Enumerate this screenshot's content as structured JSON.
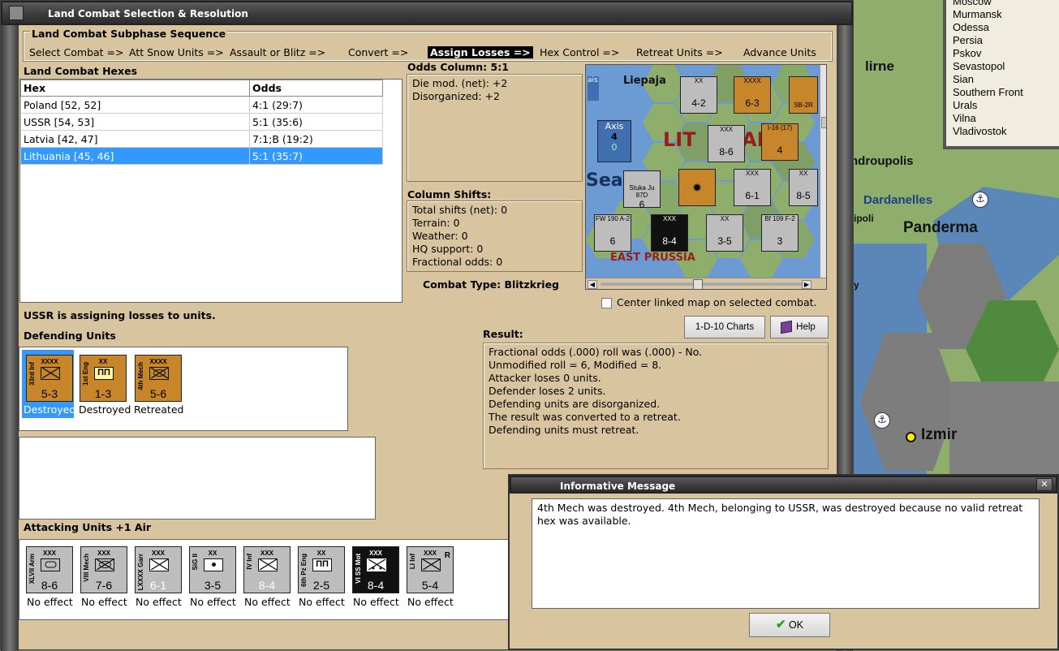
{
  "background_map": {
    "labels": {
      "lirne": "lirne",
      "androupolis": "ndroupolis",
      "dardanelles": "Dardanelles",
      "panderma": "Panderma",
      "ipoli": "ipoli",
      "izmir": "Izmir",
      "y": "y"
    },
    "city_list": [
      "Moscow",
      "Murmansk",
      "Odessa",
      "Persia",
      "Pskov",
      "Sevastopol",
      "Sian",
      "Southern Front",
      "Urals",
      "Vilna",
      "Vladivostok"
    ]
  },
  "window": {
    "title": "Land Combat Selection & Resolution",
    "close_glyph": "✕"
  },
  "sequence": {
    "heading": "Land Combat Subphase Sequence",
    "steps": [
      "Select Combat =>",
      "Att Snow Units =>",
      "Assault or Blitz =>",
      "Convert =>",
      "Assign Losses =>",
      "Hex Control =>",
      "Retreat Units =>",
      "Advance Units"
    ],
    "active_index": 4
  },
  "hexes": {
    "heading": "Land Combat Hexes",
    "columns": [
      "Hex",
      "Odds"
    ],
    "rows": [
      {
        "hex": "Poland [52, 52]",
        "odds": "4:1 (29:7)"
      },
      {
        "hex": "USSR [54, 53]",
        "odds": "5:1 (35:6)"
      },
      {
        "hex": "Latvia [42, 47]",
        "odds": "7:1;B (19:2)"
      },
      {
        "hex": "Lithuania [45, 46]",
        "odds": "5:1 (35:7)"
      }
    ],
    "selected_index": 3
  },
  "odds": {
    "heading": "Odds Column: 5:1",
    "lines": [
      "Die mod. (net): +2",
      "Disorganized: +2"
    ]
  },
  "shifts": {
    "heading": "Column Shifts:",
    "lines": [
      "Total shifts (net): 0",
      "Terrain: 0",
      "Weather: 0",
      "HQ support: 0",
      "Fractional odds: 0"
    ]
  },
  "combat_type": "Combat Type:  Blitzkrieg",
  "center_linked": "Center linked map on selected combat.",
  "assigning": "USSR is assigning losses to units.",
  "defending": {
    "heading": "Defending Units",
    "units": [
      {
        "label": "33rd Inf",
        "size": "XXXX",
        "strength": "5-3",
        "status": "Destroyed",
        "selected": true
      },
      {
        "label": "1st Eng",
        "size": "XX",
        "strength": "1-3",
        "status": "Destroyed",
        "selected": false
      },
      {
        "label": "4th Mech",
        "size": "XXXX",
        "strength": "5-6",
        "status": "Retreated",
        "selected": false
      }
    ]
  },
  "attacking": {
    "heading": "Attacking Units +1 Air",
    "units": [
      {
        "label": "XLVII Arm",
        "size": "XXX",
        "strength": "8-6",
        "status": "No effect"
      },
      {
        "label": "VIII Mech",
        "size": "XXX",
        "strength": "7-6",
        "status": "No effect"
      },
      {
        "label": "LXXXX Garr",
        "size": "XXX",
        "strength": "6-1",
        "status": "No effect"
      },
      {
        "label": "SiG II",
        "size": "XX",
        "strength": "3-5",
        "status": "No effect"
      },
      {
        "label": "IV Inf",
        "size": "XXX",
        "strength": "8-4",
        "status": "No effect"
      },
      {
        "label": "6th Pz Eng",
        "size": "XX",
        "strength": "2-5",
        "status": "No effect"
      },
      {
        "label": "VI SS Mot",
        "size": "XXX",
        "strength": "8-4",
        "status": "No effect"
      },
      {
        "label": "LI Inf",
        "size": "XXX",
        "strength": "5-4",
        "status": "No effect",
        "reserve": "R"
      }
    ]
  },
  "buttons": {
    "charts": "1-D-10 Charts",
    "help": "Help",
    "ok": "OK"
  },
  "result": {
    "heading": "Result:",
    "lines": [
      "Fractional odds (.000) roll was (.000)  - No.",
      "Unmodified roll = 6, Modified = 8.",
      "Attacker loses 0 units.",
      "Defender loses 2 units.",
      "Defending units are disorganized.",
      "The result was converted to a retreat.",
      "Defending units must retreat."
    ]
  },
  "minimap": {
    "liepaja": "Liepaja",
    "lit": "LIT",
    "ai": "AI",
    "sea": "Sea",
    "east_prussia": "EAST PRUSSIA",
    "axis_box": {
      "label": "Axis",
      "num": "4",
      "sub": "0"
    },
    "ais_fragment": "ais",
    "counters": [
      {
        "label": "XX",
        "strength": "4-2"
      },
      {
        "label": "XXXX",
        "strength": "6-3"
      },
      {
        "label": "XXX",
        "strength": "8-6"
      },
      {
        "label": "I-16 (17)",
        "strength": "4"
      },
      {
        "label": "Stuka Ju 87D",
        "strength": "6"
      },
      {
        "label": "XXX",
        "strength": "6-1"
      },
      {
        "label": "XX",
        "strength": "8-5"
      },
      {
        "label": "FW 190 A-2",
        "strength": "6"
      },
      {
        "label": "XXX",
        "strength": "8-4"
      },
      {
        "label": "XX",
        "strength": "3-5"
      },
      {
        "label": "Bf 109 F-2",
        "strength": "3"
      },
      {
        "label": "SB-2R",
        "strength": ""
      }
    ]
  },
  "dialog": {
    "title": "Informative Message",
    "message": "4th Mech was destroyed.  4th Mech, belonging to USSR, was destroyed because no valid retreat hex was available."
  }
}
